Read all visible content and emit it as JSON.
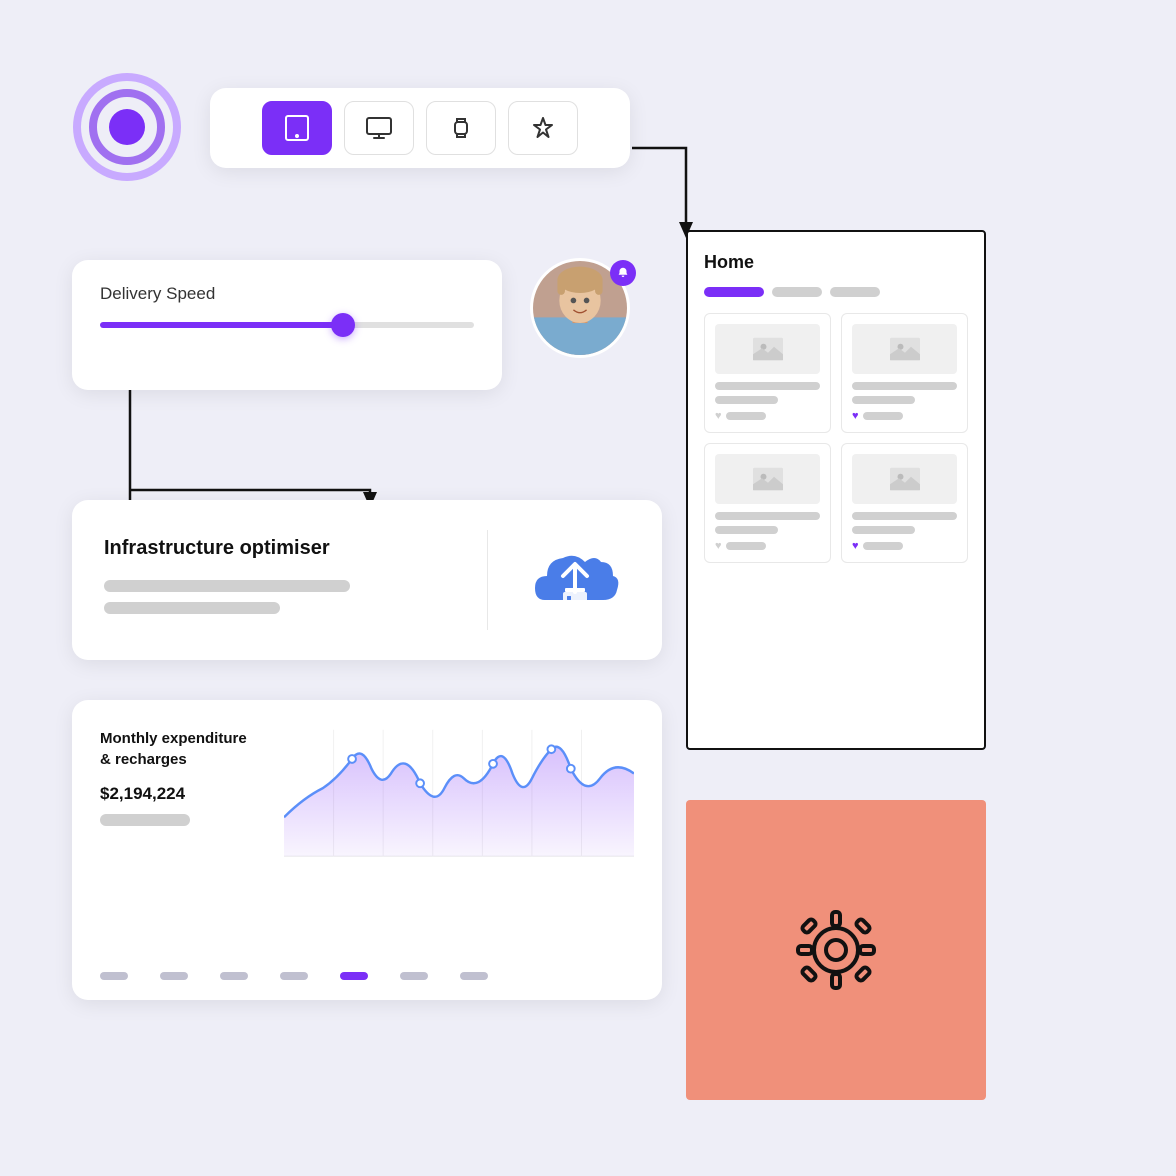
{
  "background_color": "#eeeef7",
  "target_icon": {
    "rings": [
      "#7B2FF7",
      "#a070f0",
      "#c8aaff"
    ],
    "label": "target-icon"
  },
  "device_selector": {
    "buttons": [
      {
        "id": "tablet",
        "label": "tablet",
        "active": true
      },
      {
        "id": "desktop",
        "label": "desktop",
        "active": false
      },
      {
        "id": "watch",
        "label": "watch",
        "active": false
      },
      {
        "id": "star",
        "label": "star",
        "active": false
      }
    ]
  },
  "delivery_speed": {
    "label": "Delivery Speed",
    "slider_value": 65,
    "color": "#7B2FF7"
  },
  "avatar": {
    "has_notification": true,
    "notification_color": "#7B2FF7"
  },
  "infrastructure": {
    "title": "Infrastructure optimiser",
    "line1_width": "70%",
    "line2_width": "50%",
    "cloud_color": "#4a7de8"
  },
  "chart": {
    "title": "Monthly expenditure\n& recharges",
    "value": "$2,194,224",
    "accent_color": "#7B2FF7",
    "dots": [
      false,
      false,
      false,
      false,
      true,
      false,
      false
    ]
  },
  "home_panel": {
    "title": "Home",
    "tabs": [
      {
        "active": true
      },
      {
        "active": false
      },
      {
        "active": false
      }
    ],
    "grid_items": [
      {
        "has_heart": false
      },
      {
        "has_heart": true
      },
      {
        "has_heart": false
      },
      {
        "has_heart": true
      }
    ]
  },
  "settings": {
    "background_color": "#f0907a",
    "icon": "gear"
  },
  "arrows": {
    "color": "#111111"
  }
}
